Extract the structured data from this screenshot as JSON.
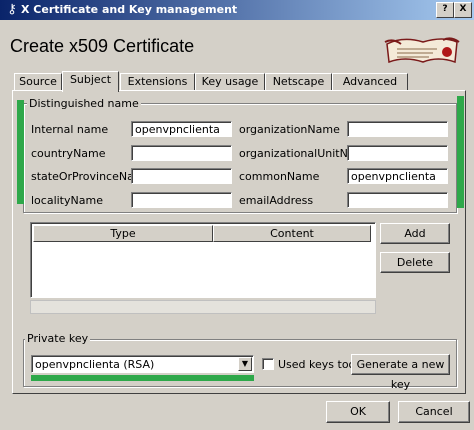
{
  "window": {
    "title": "X Certificate and Key management",
    "help_btn": "?",
    "close_btn": "X"
  },
  "heading": "Create x509 Certificate",
  "tabs": [
    "Source",
    "Subject",
    "Extensions",
    "Key usage",
    "Netscape",
    "Advanced"
  ],
  "active_tab": "Subject",
  "distinguished": {
    "title": "Distinguished name",
    "fields": [
      {
        "label": "Internal name",
        "value": "openvpnclienta"
      },
      {
        "label": "organizationName",
        "value": ""
      },
      {
        "label": "countryName",
        "value": ""
      },
      {
        "label": "organizationalUnitName",
        "value": ""
      },
      {
        "label": "stateOrProvinceName",
        "value": ""
      },
      {
        "label": "commonName",
        "value": "openvpnclienta"
      },
      {
        "label": "localityName",
        "value": ""
      },
      {
        "label": "emailAddress",
        "value": ""
      }
    ]
  },
  "table": {
    "columns": [
      "Type",
      "Content"
    ],
    "add": "Add",
    "delete": "Delete"
  },
  "private_key": {
    "title": "Private key",
    "selected": "openvpnclienta (RSA)",
    "used_keys_too": "Used keys too",
    "generate": "Generate a new key"
  },
  "footer": {
    "ok": "OK",
    "cancel": "Cancel"
  },
  "colors": {
    "title_start": "#0a246a",
    "title_end": "#a6caf0",
    "highlight_green": "#2ea84a",
    "face": "#d4d0c8"
  }
}
